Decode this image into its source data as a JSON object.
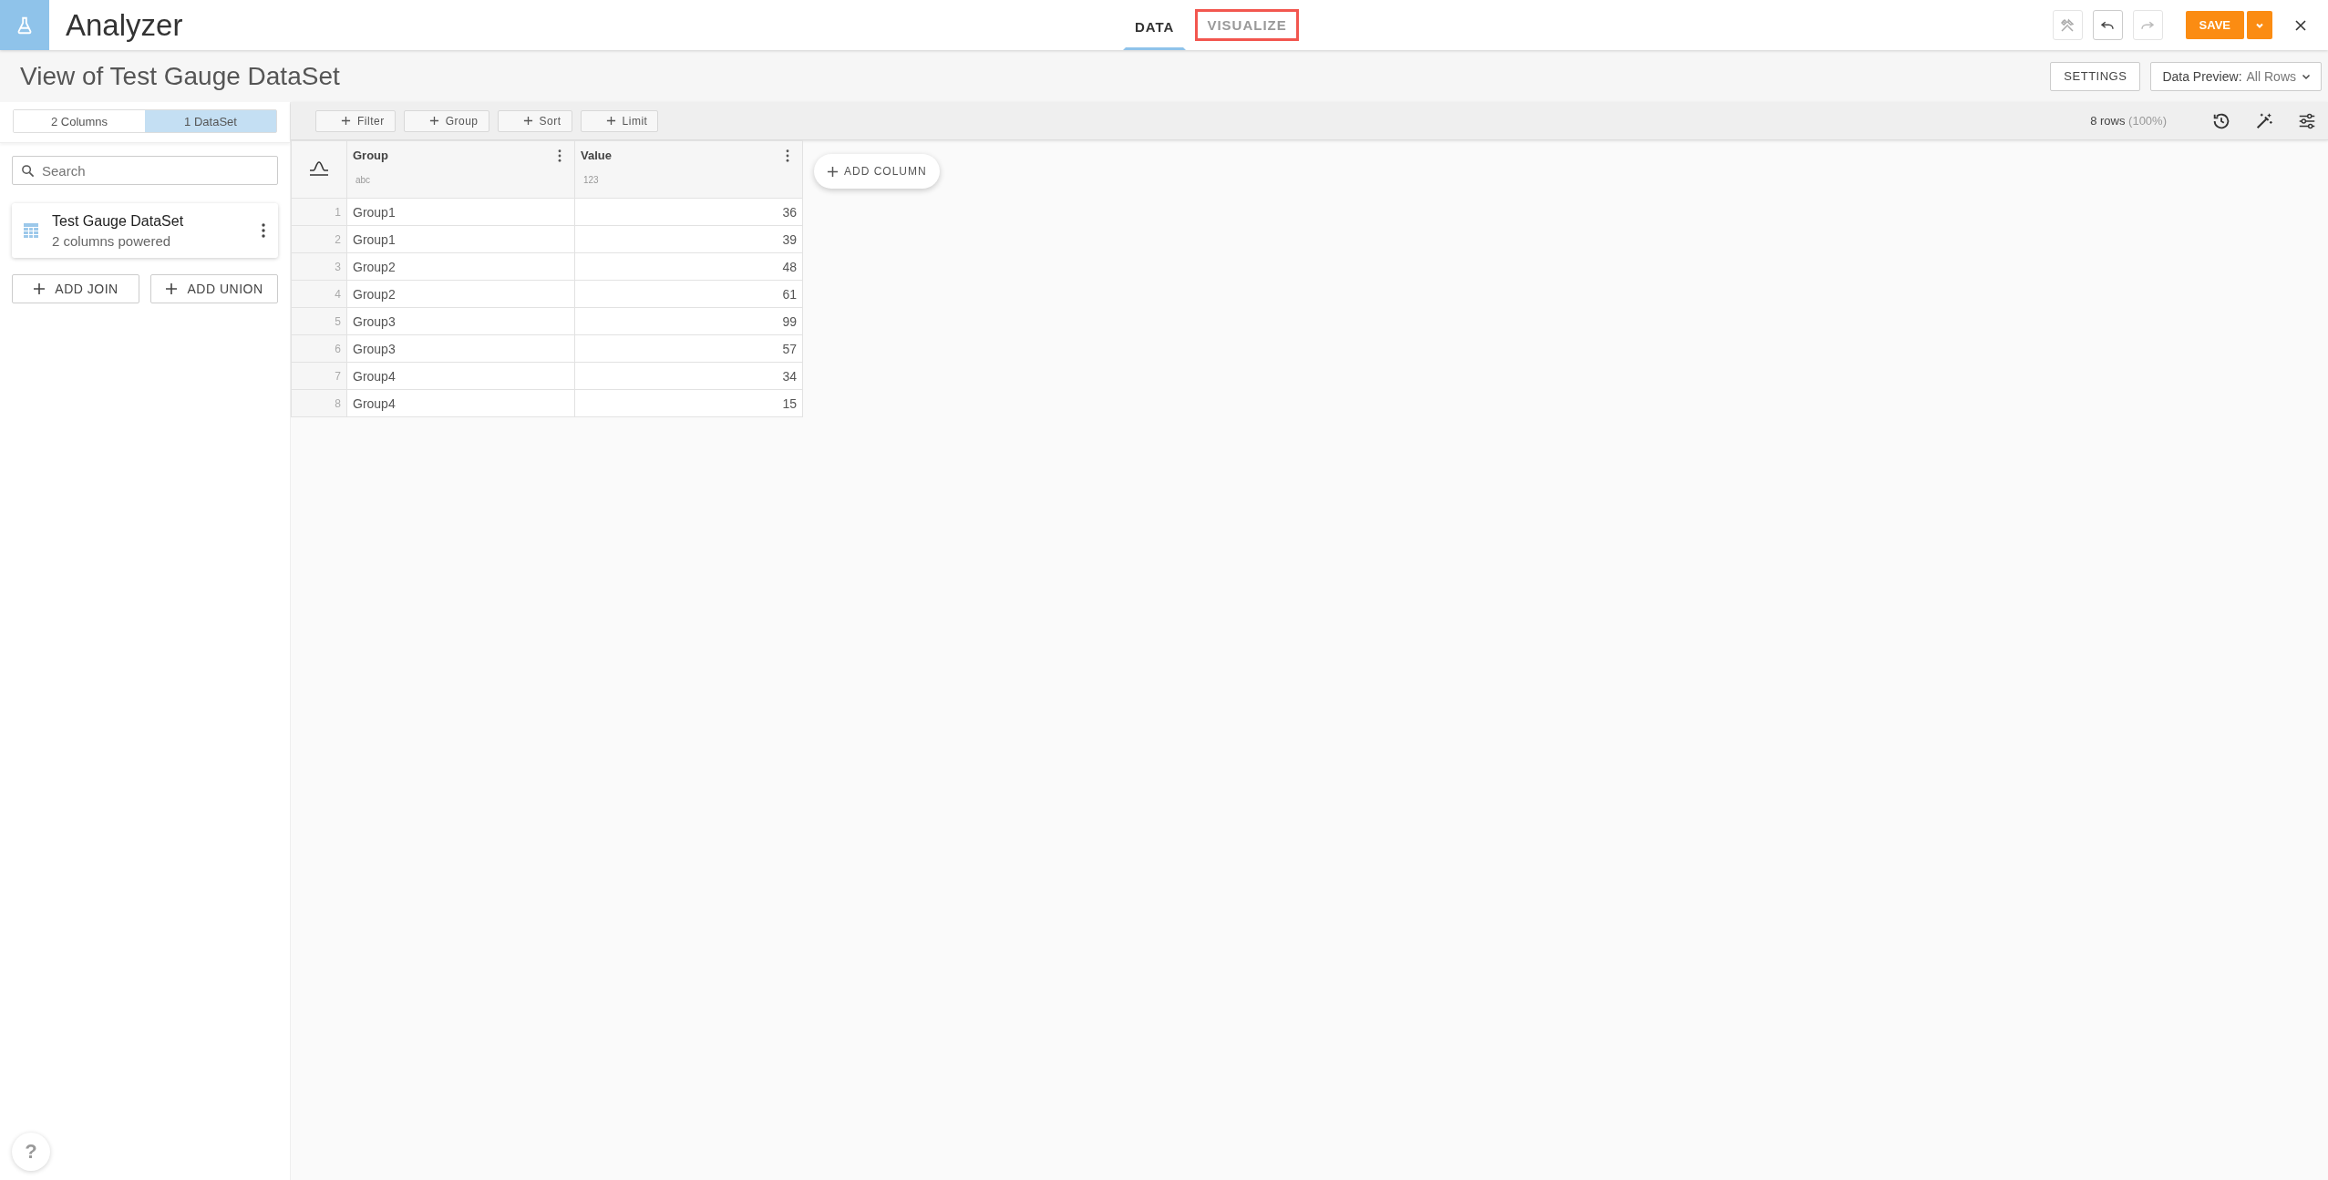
{
  "app": {
    "title": "Analyzer"
  },
  "tabs": [
    {
      "label": "DATA",
      "selected": true,
      "highlighted": false
    },
    {
      "label": "VISUALIZE",
      "selected": false,
      "highlighted": true
    }
  ],
  "header_actions": {
    "save": "SAVE"
  },
  "page_title": "View of Test Gauge DataSet",
  "settings_button": "SETTINGS",
  "preview": {
    "label": "Data Preview:",
    "value": "All Rows"
  },
  "sidebar": {
    "segments": [
      {
        "label": "2 Columns",
        "selected": false
      },
      {
        "label": "1 DataSet",
        "selected": true
      }
    ],
    "search": {
      "placeholder": "Search"
    },
    "datasets": [
      {
        "name": "Test Gauge DataSet",
        "subtitle": "2 columns powered"
      }
    ],
    "buttons": [
      "ADD JOIN",
      "ADD UNION"
    ]
  },
  "toolbar": {
    "buttons": [
      "Filter",
      "Group",
      "Sort",
      "Limit"
    ],
    "row_count": "8 rows",
    "percent": "(100%)"
  },
  "table": {
    "columns": [
      {
        "name": "Group",
        "type": "abc",
        "kind": "text"
      },
      {
        "name": "Value",
        "type": "123",
        "kind": "number"
      }
    ],
    "rows": [
      {
        "index": "1",
        "cells": [
          "Group1",
          "36"
        ]
      },
      {
        "index": "2",
        "cells": [
          "Group1",
          "39"
        ]
      },
      {
        "index": "3",
        "cells": [
          "Group2",
          "48"
        ]
      },
      {
        "index": "4",
        "cells": [
          "Group2",
          "61"
        ]
      },
      {
        "index": "5",
        "cells": [
          "Group3",
          "99"
        ]
      },
      {
        "index": "6",
        "cells": [
          "Group3",
          "57"
        ]
      },
      {
        "index": "7",
        "cells": [
          "Group4",
          "34"
        ]
      },
      {
        "index": "8",
        "cells": [
          "Group4",
          "15"
        ]
      }
    ]
  },
  "add_column": "ADD COLUMN",
  "help": "?"
}
